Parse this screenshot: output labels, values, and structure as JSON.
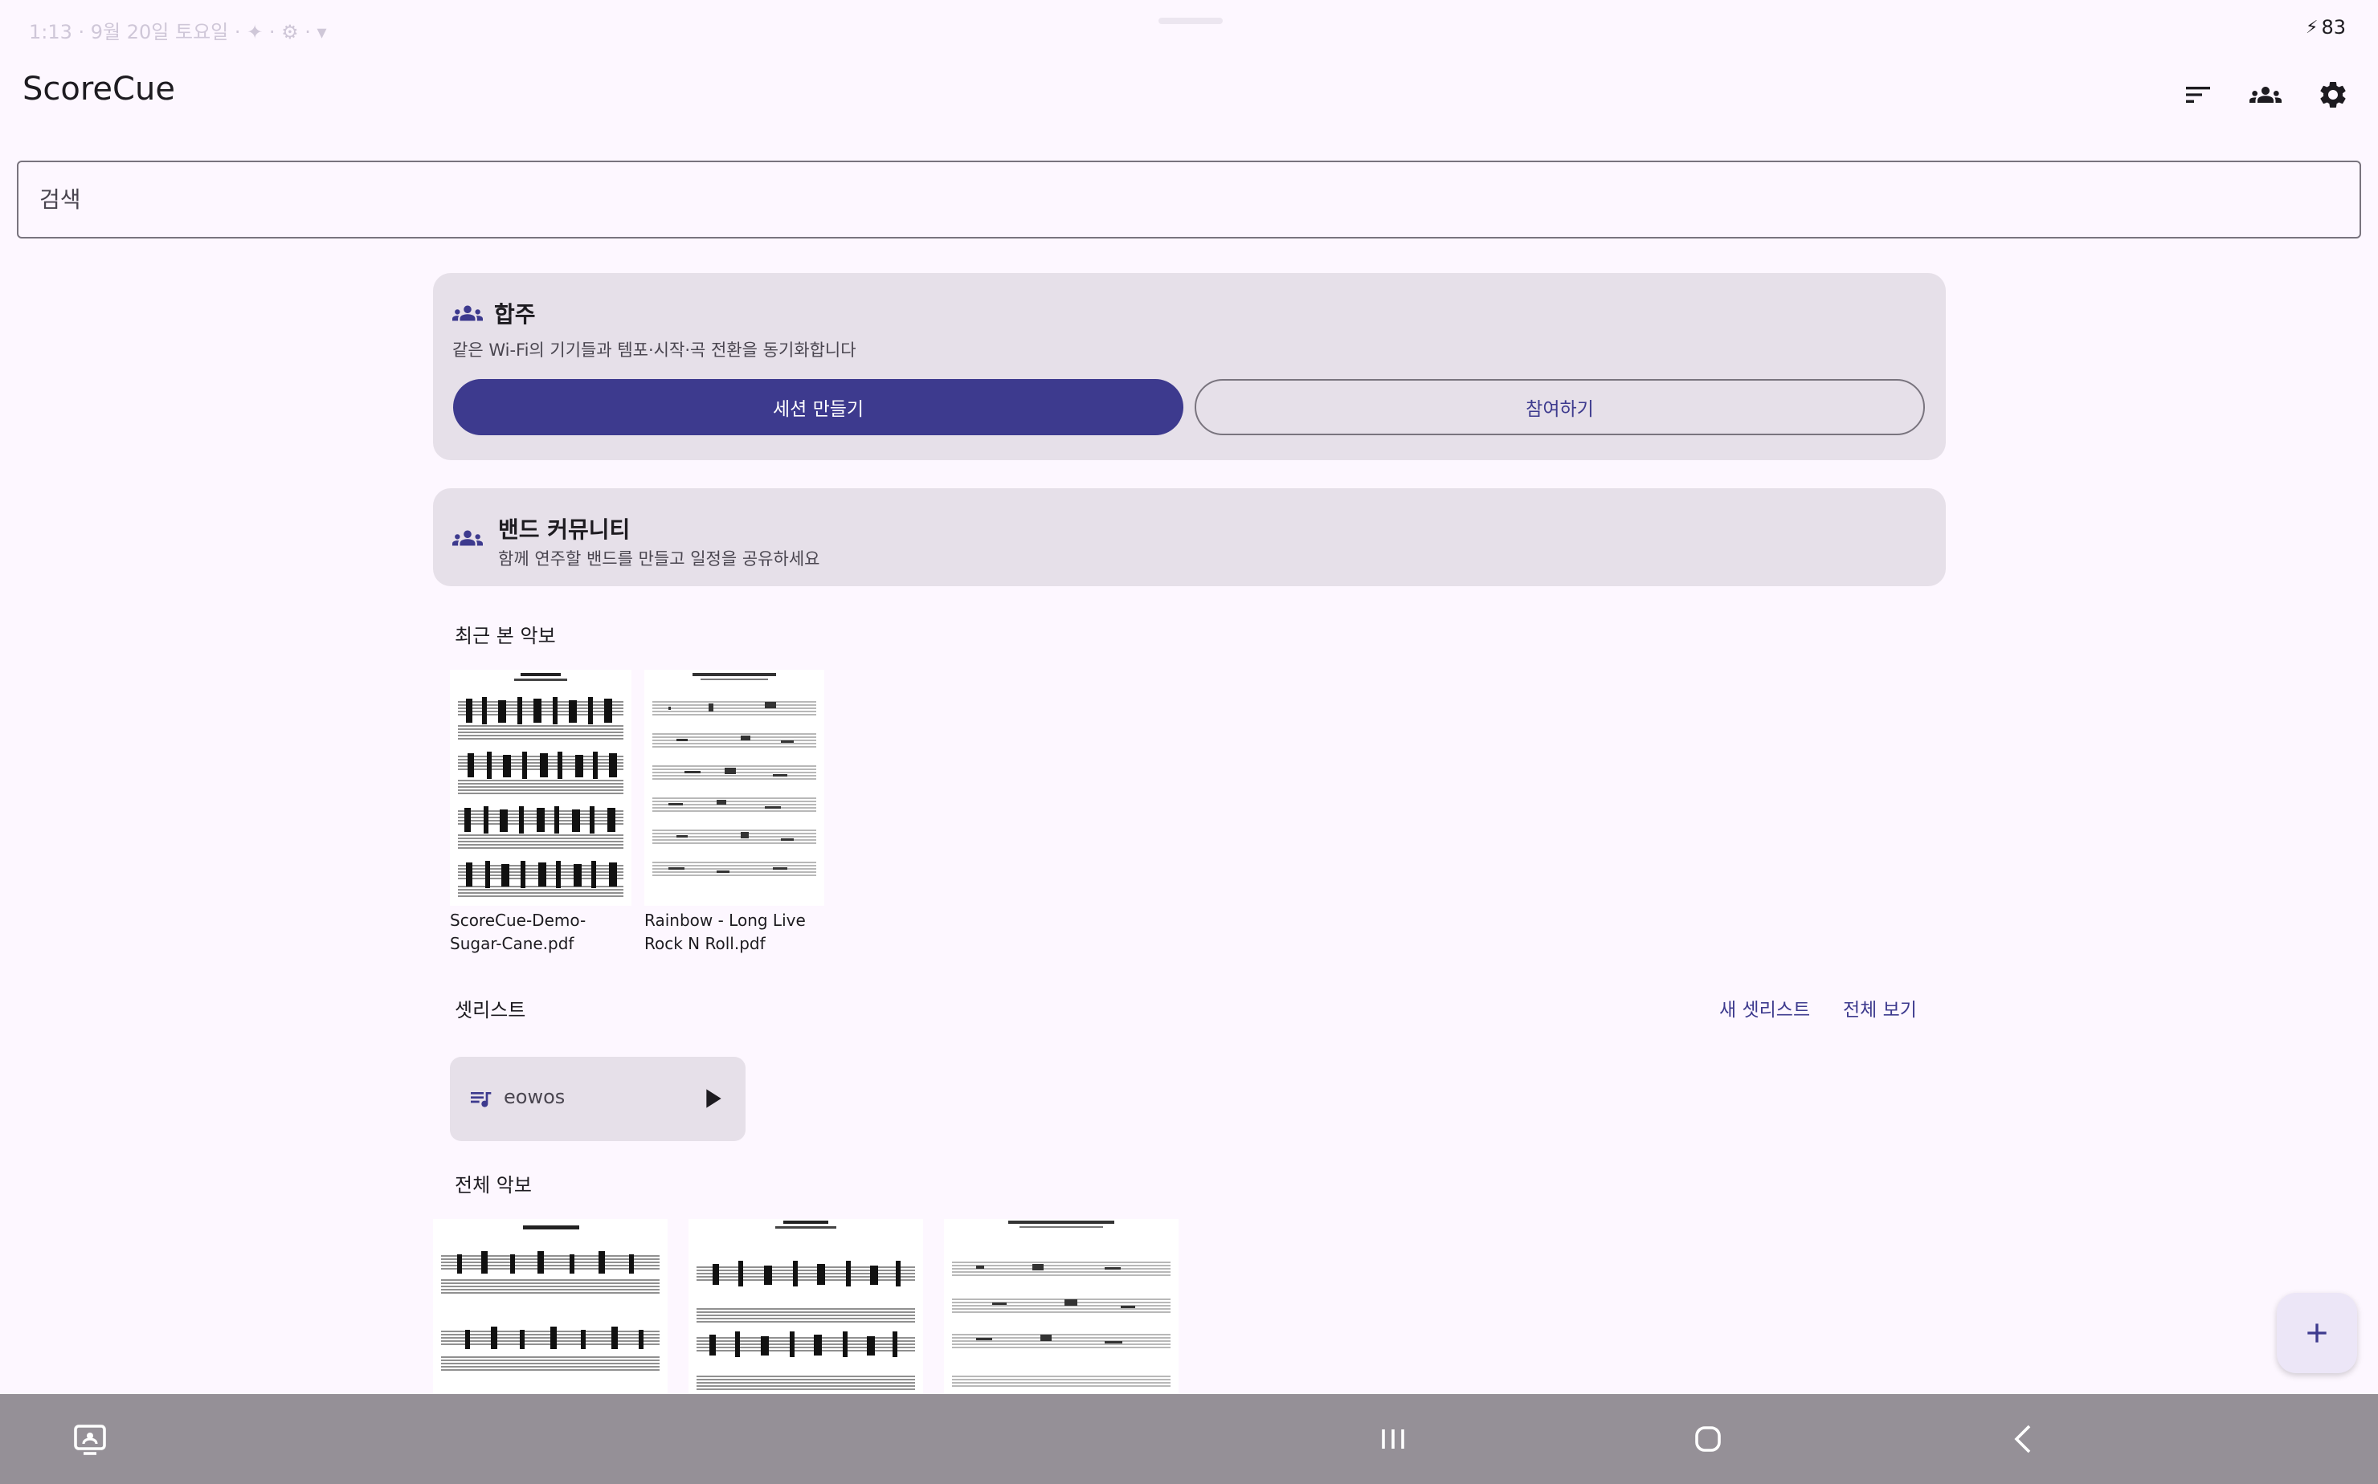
{
  "status_bar": {
    "left_text": "1:13 · 9월 20일 토요일 · ✦ · ⚙ · ▾",
    "battery": "83"
  },
  "app": {
    "title": "ScoreCue"
  },
  "search": {
    "placeholder": "검색"
  },
  "ensemble": {
    "title": "합주",
    "description": "같은 Wi-Fi의 기기들과 템포·시작·곡 전환을 동기화합니다",
    "create_label": "세션 만들기",
    "join_label": "참여하기"
  },
  "band": {
    "title": "밴드 커뮤니티",
    "description": "함께 연주할 밴드를 만들고 일정을 공유하세요"
  },
  "recent": {
    "title": "최근 본 악보",
    "items": [
      {
        "filename": "ScoreCue-Demo-Sugar-Cane.pdf"
      },
      {
        "filename": "Rainbow - Long Live Rock N Roll.pdf"
      }
    ]
  },
  "setlists": {
    "title": "셋리스트",
    "new_label": "새 셋리스트",
    "view_all_label": "전체 보기",
    "items": [
      {
        "name": "eowos"
      }
    ]
  },
  "all_scores": {
    "title": "전체 악보"
  },
  "icons": {
    "sort": "sort-icon",
    "group": "group-icon",
    "settings": "gear-icon",
    "queue_music": "queue-music-icon",
    "play": "play-icon",
    "add": "add-icon"
  },
  "colors": {
    "primary": "#3d3a8e",
    "surface": "#fdf7ff",
    "card": "#e6e0e9",
    "nav_bar": "#959097"
  }
}
